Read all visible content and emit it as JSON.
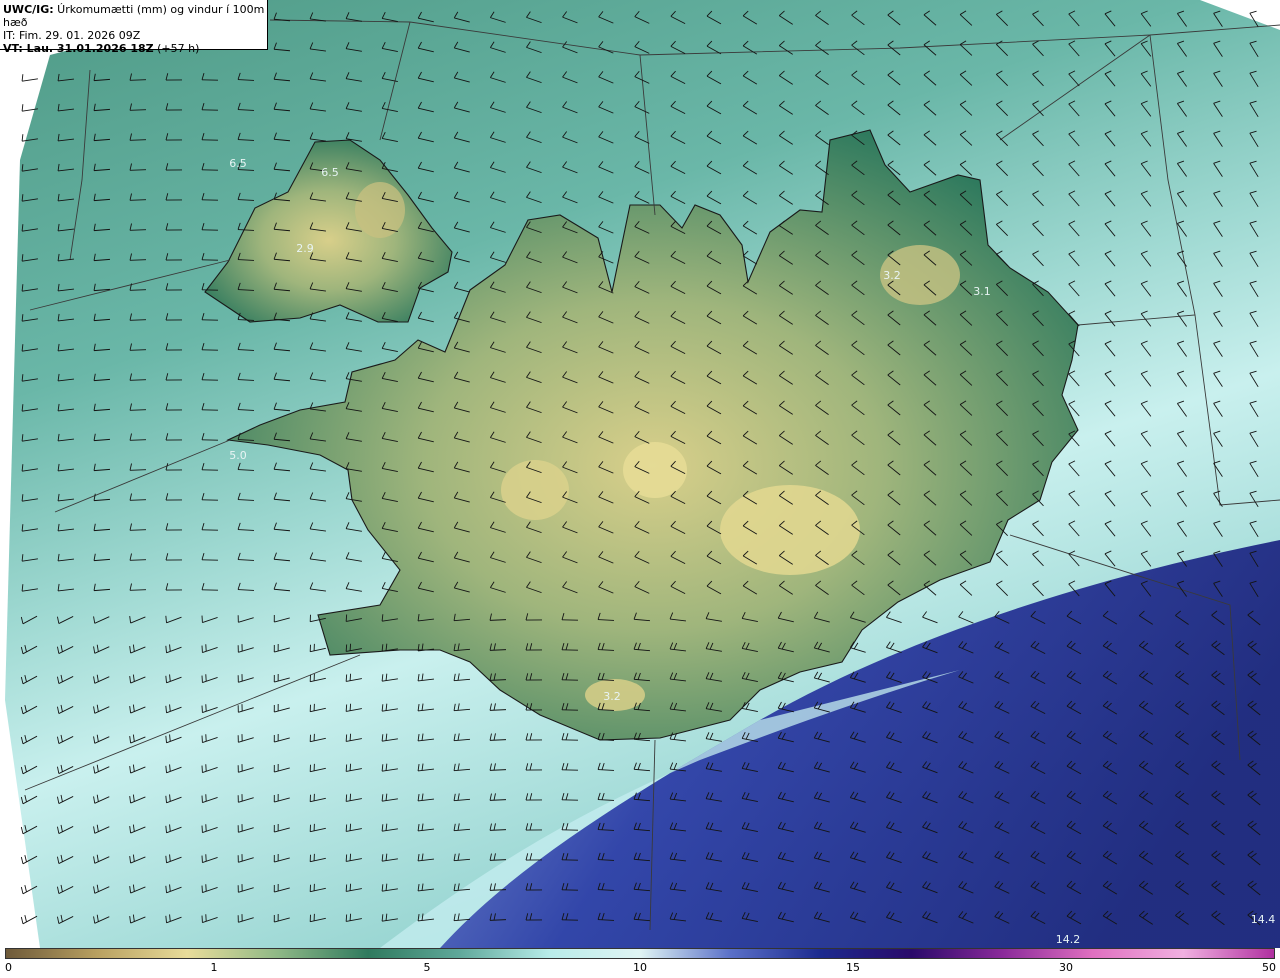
{
  "header": {
    "title_bold": "UWC/IG:",
    "title_rest": " Úrkomumætti (mm) og vindur í 100m hæð",
    "it_line": "IT: Fim. 29. 01. 2026 09Z",
    "vt_bold": "VT: Lau. 31.01.2026 18Z",
    "vt_rest": " (+57 h)"
  },
  "map_labels": [
    "6.5",
    "6.5",
    "2.9",
    "5.0",
    "3.2",
    "3.1",
    "3.2",
    "14.2",
    "14.4"
  ],
  "colorbar": {
    "ticks": [
      "0",
      "1",
      "5",
      "10",
      "15",
      "30",
      "50"
    ],
    "colors": [
      "#6e5a3a",
      "#b8a060",
      "#e8dc9a",
      "#8fb886",
      "#2f7a5e",
      "#5fa89a",
      "#b8ece9",
      "#e0f4f4",
      "#5a70c8",
      "#1c2a8e",
      "#2a0a6a",
      "#8a2a9a",
      "#e070c0",
      "#f0b0e0",
      "#b030a0"
    ]
  },
  "legend_colors": {
    "sea_light": "#b8ece9",
    "sea_mid": "#6ab7a8",
    "land_low": "#2f7a5e",
    "land_high": "#d8cf8a",
    "rain_heavy": "#1c2080"
  }
}
